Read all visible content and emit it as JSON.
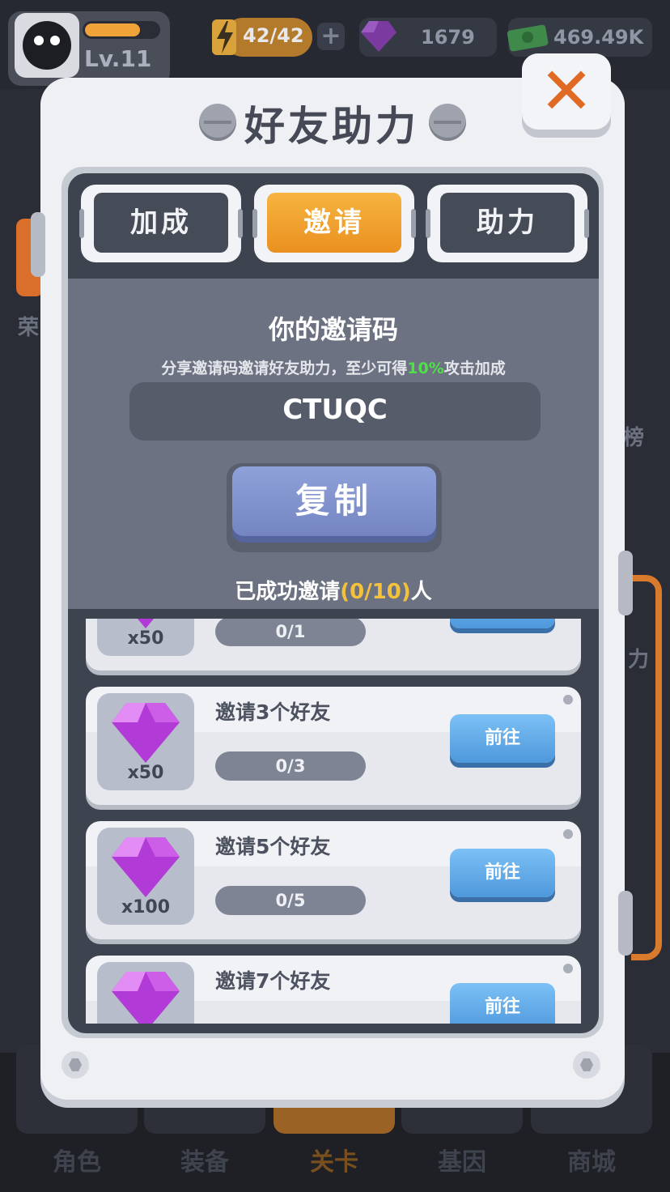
{
  "hud": {
    "level": "Lv.11",
    "xp_fraction": 0.75,
    "energy": "42/42",
    "gems": "1679",
    "cash": "469.49K"
  },
  "nav": [
    "角色",
    "装备",
    "关卡",
    "基因",
    "商城"
  ],
  "side_labels": [
    "荣",
    "榜",
    "力"
  ],
  "dialog": {
    "title": "好友助力",
    "tabs": [
      "加成",
      "邀请",
      "助力"
    ],
    "active_tab": "邀请",
    "invite_title": "你的邀请码",
    "invite_desc_pre": "分享邀请码邀请好友助力，至少可得",
    "invite_desc_pct": "10%",
    "invite_desc_post": "攻击加成",
    "invite_code": "CTUQC",
    "copy_label": "复制",
    "invited_pre": "已成功邀请",
    "invited_count": "(0/10)",
    "invited_post": "人"
  },
  "tasks": [
    {
      "title": "",
      "qty": "x50",
      "progress": "0/1",
      "button": ""
    },
    {
      "title": "邀请3个好友",
      "qty": "x50",
      "progress": "0/3",
      "button": "前往"
    },
    {
      "title": "邀请5个好友",
      "qty": "x100",
      "progress": "0/5",
      "button": "前往"
    },
    {
      "title": "邀请7个好友",
      "qty": "",
      "progress": "",
      "button": "前往"
    }
  ],
  "colors": {
    "accent": "#f2a32e",
    "highlight_green": "#4fe046",
    "highlight_yellow": "#f4c13a",
    "go_button": "#5aa6e6",
    "close_x": "#e06a24"
  }
}
